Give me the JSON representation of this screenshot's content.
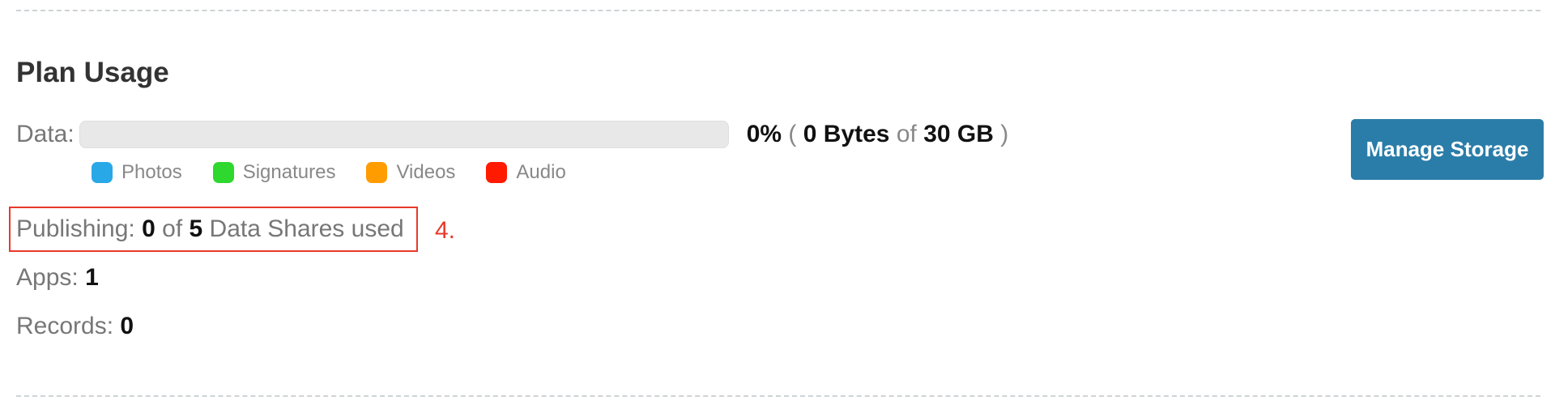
{
  "section": {
    "title": "Plan Usage"
  },
  "data_usage": {
    "label": "Data:",
    "percent": "0%",
    "open_paren": "(",
    "used": "0 Bytes",
    "of": "of",
    "total": "30 GB",
    "close_paren": ")",
    "used_fraction": 0,
    "segments": [
      {
        "key": "photos",
        "fraction": 0
      },
      {
        "key": "signatures",
        "fraction": 0
      },
      {
        "key": "videos",
        "fraction": 0
      },
      {
        "key": "audio",
        "fraction": 0
      }
    ]
  },
  "legend": [
    {
      "label": "Photos",
      "color": "#29a8e8"
    },
    {
      "label": "Signatures",
      "color": "#2ed82e"
    },
    {
      "label": "Videos",
      "color": "#ff9c00"
    },
    {
      "label": "Audio",
      "color": "#ff1a00"
    }
  ],
  "manage_button": {
    "label": "Manage Storage",
    "color": "#2a7da8"
  },
  "publishing": {
    "label": "Publishing:",
    "used": "0",
    "of": "of",
    "total": "5",
    "suffix": "Data Shares used"
  },
  "apps": {
    "label": "Apps:",
    "value": "1"
  },
  "records": {
    "label": "Records:",
    "value": "0"
  },
  "annotation": {
    "number": "4.",
    "color": "#e8392a"
  }
}
